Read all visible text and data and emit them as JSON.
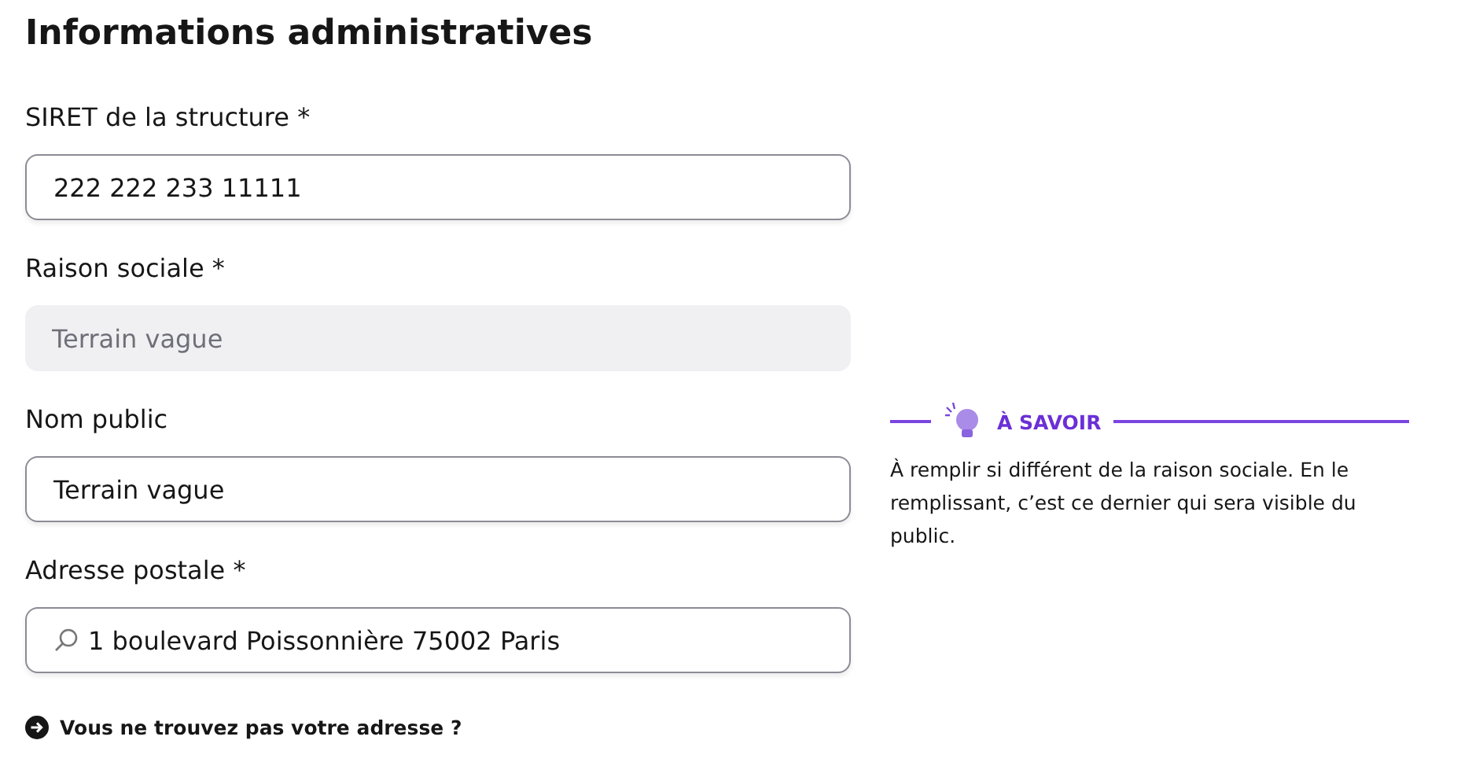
{
  "title": "Informations administratives",
  "fields": [
    {
      "label": "SIRET de la structure *",
      "kind": "text",
      "value": "222 222 233 11111",
      "disabled": false
    },
    {
      "label": "Raison sociale *",
      "kind": "text",
      "value": "Terrain vague",
      "disabled": true
    },
    {
      "label": "Nom public",
      "kind": "text",
      "value": "Terrain vague",
      "disabled": false
    },
    {
      "label": "Adresse postale *",
      "kind": "search",
      "value": "1 boulevard Poissonnière 75002 Paris",
      "disabled": false
    }
  ],
  "help_link": "Vous ne trouvez pas votre adresse ?",
  "info": {
    "heading": "À SAVOIR",
    "text": "À remplir si différent de la raison sociale. En le remplissant, c’est ce dernier qui sera visible du public."
  }
}
